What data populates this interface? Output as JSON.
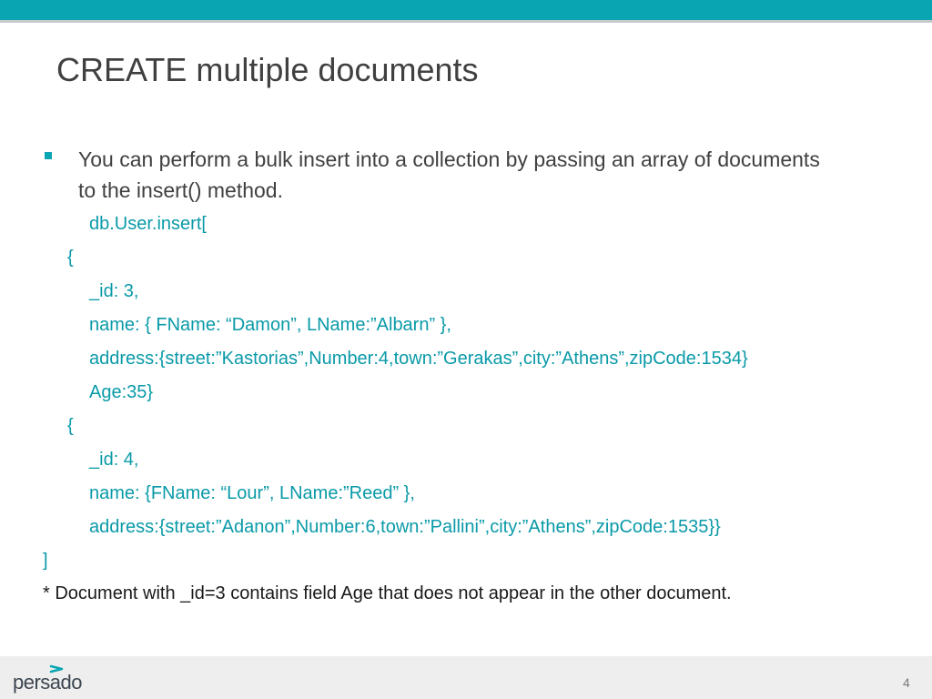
{
  "slide": {
    "title": "CREATE multiple documents",
    "bullet": "You can perform a bulk insert into a collection by passing an array of documents to the insert() method.",
    "code_lines": [
      "db.User.insert[",
      "{",
      "_id: 3,",
      " name: { FName: “Damon”, LName:”Albarn” },",
      "address:{street:”Kastorias”,Number:4,town:”Gerakas”,city:”Athens”,zipCode:1534}",
      "Age:35}",
      "{",
      " _id: 4,",
      " name: {FName: “Lour”, LName:”Reed” },",
      "address:{street:”Adanon”,Number:6,town:”Pallini”,city:”Athens”,zipCode:1535}}",
      "]"
    ],
    "note": "* Document with _id=3 contains field Age that does not appear in the other document.",
    "page_number": "4"
  },
  "footer": {
    "logo_text": "persado"
  },
  "colors": {
    "accent": "#0aa5b3",
    "code": "#0a9aa8",
    "text": "#404040",
    "footer_bg": "#eeeeee"
  }
}
